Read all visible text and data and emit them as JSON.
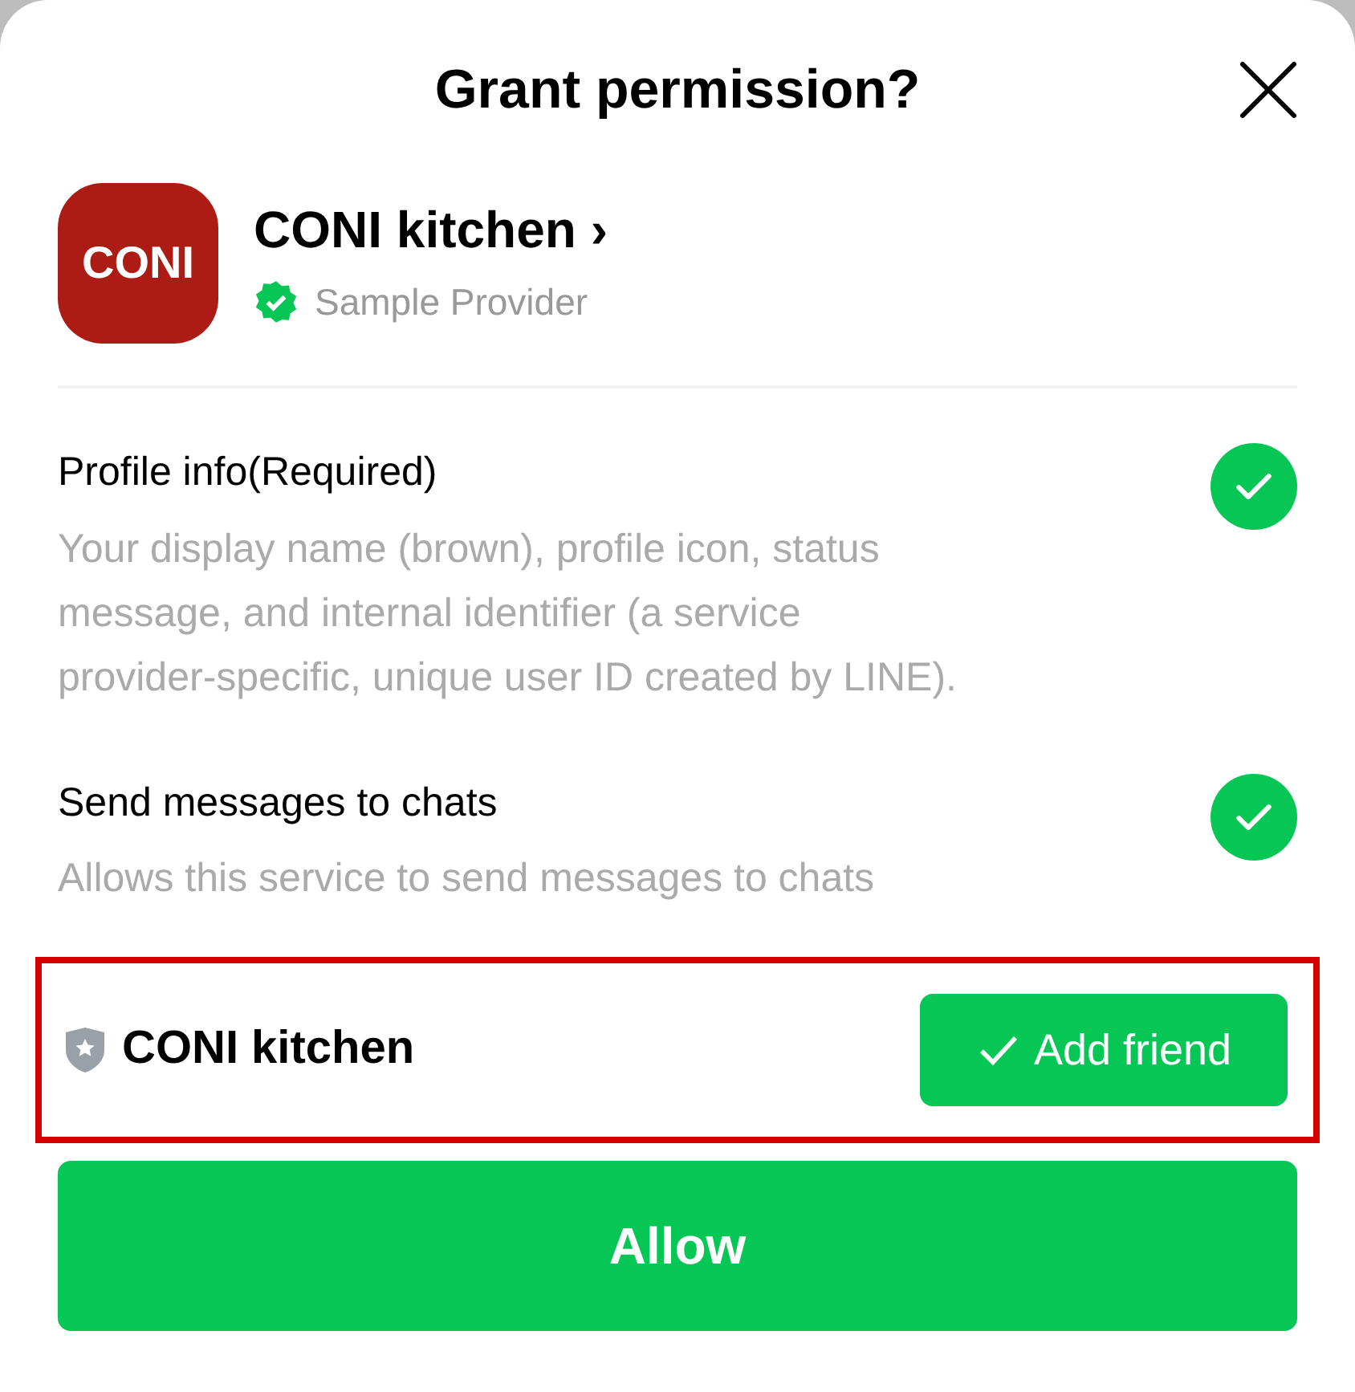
{
  "dialog": {
    "title": "Grant permission?"
  },
  "provider": {
    "logo_text": "CONI",
    "name": "CONI kitchen",
    "chevron": "›",
    "subtitle": "Sample Provider"
  },
  "permissions": [
    {
      "title": "Profile info(Required)",
      "description": "Your display name (brown), profile icon, status message, and internal identifier (a service provider-specific, unique user ID created by LINE).",
      "checked": true
    },
    {
      "title": "Send messages to chats",
      "description": "Allows this service to send messages to chats",
      "checked": true
    }
  ],
  "friend_option": {
    "name": "CONI kitchen",
    "button": "Add friend",
    "selected": true
  },
  "allow_button": "Allow"
}
